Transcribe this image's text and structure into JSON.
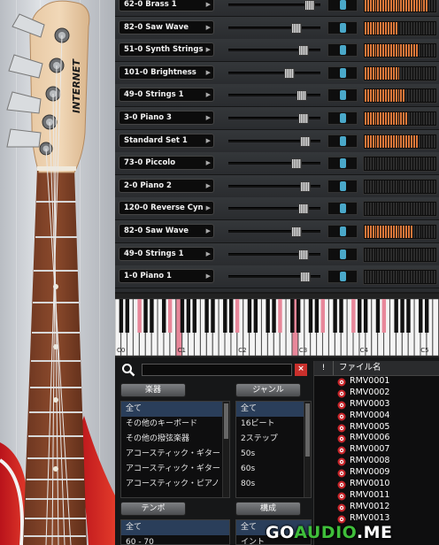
{
  "guitar": {
    "headstock_logo": "INTERNET"
  },
  "channels": [
    {
      "name": "62-0 Brass 1",
      "fader": 0.88,
      "pan": 0.5,
      "meter": [
        1,
        1,
        1,
        1,
        1,
        1,
        1,
        1,
        1,
        1,
        1,
        1,
        1,
        1,
        1,
        1,
        1,
        1,
        1,
        1,
        1,
        1,
        1,
        1,
        1,
        0,
        0,
        0
      ]
    },
    {
      "name": "82-0 Saw Wave",
      "fader": 0.74,
      "pan": 0.5,
      "meter": [
        1,
        1,
        1,
        1,
        1,
        1,
        1,
        1,
        1,
        1,
        1,
        1,
        1,
        0,
        0,
        0,
        0,
        0,
        0,
        0,
        0,
        0,
        0,
        0,
        0,
        0,
        0,
        0
      ]
    },
    {
      "name": "51-0 Synth Strings",
      "fader": 0.82,
      "pan": 0.5,
      "meter": [
        1,
        1,
        1,
        1,
        1,
        1,
        1,
        1,
        1,
        1,
        1,
        1,
        1,
        1,
        1,
        1,
        1,
        1,
        1,
        1,
        1,
        0,
        0,
        0,
        0,
        0,
        0,
        0
      ]
    },
    {
      "name": "101-0 Brightness",
      "fader": 0.66,
      "pan": 0.5,
      "meter": [
        1,
        1,
        1,
        1,
        1,
        1,
        1,
        1,
        1,
        1,
        1,
        1,
        1,
        1,
        0,
        0,
        0,
        0,
        0,
        0,
        0,
        0,
        0,
        0,
        0,
        0,
        0,
        0
      ]
    },
    {
      "name": "49-0 Strings 1",
      "fader": 0.8,
      "pan": 0.5,
      "meter": [
        1,
        1,
        1,
        1,
        1,
        1,
        1,
        1,
        1,
        1,
        1,
        1,
        1,
        1,
        1,
        1,
        0,
        0,
        0,
        0,
        0,
        0,
        0,
        0,
        0,
        0,
        0,
        0
      ]
    },
    {
      "name": "3-0 Piano 3",
      "fader": 0.82,
      "pan": 0.5,
      "meter": [
        1,
        1,
        1,
        1,
        1,
        1,
        1,
        1,
        1,
        1,
        1,
        1,
        1,
        1,
        1,
        1,
        1,
        0,
        0,
        0,
        0,
        0,
        0,
        0,
        0,
        0,
        0,
        0
      ]
    },
    {
      "name": "Standard Set 1",
      "fader": 0.84,
      "pan": 0.5,
      "meter": [
        1,
        1,
        1,
        1,
        1,
        1,
        1,
        1,
        1,
        1,
        1,
        1,
        1,
        1,
        1,
        1,
        1,
        1,
        1,
        1,
        1,
        0,
        0,
        0,
        0,
        0,
        0,
        0
      ]
    },
    {
      "name": "73-0 Piccolo",
      "fader": 0.74,
      "pan": 0.5,
      "meter": [
        0,
        0,
        0,
        0,
        0,
        0,
        0,
        0,
        0,
        0,
        0,
        0,
        0,
        0,
        0,
        0,
        0,
        0,
        0,
        0,
        0,
        0,
        0,
        0,
        0,
        0,
        0,
        0
      ]
    },
    {
      "name": "2-0 Piano 2",
      "fader": 0.84,
      "pan": 0.5,
      "meter": [
        0,
        0,
        0,
        0,
        0,
        0,
        0,
        0,
        0,
        0,
        0,
        0,
        0,
        0,
        0,
        0,
        0,
        0,
        0,
        0,
        0,
        0,
        0,
        0,
        0,
        0,
        0,
        0
      ]
    },
    {
      "name": "120-0 Reverse Cyn",
      "fader": 0.82,
      "pan": 0.5,
      "meter": [
        0,
        0,
        0,
        0,
        0,
        0,
        0,
        0,
        0,
        0,
        0,
        0,
        0,
        0,
        0,
        0,
        0,
        0,
        0,
        0,
        0,
        0,
        0,
        0,
        0,
        0,
        0,
        0
      ]
    },
    {
      "name": "82-0 Saw Wave",
      "fader": 0.74,
      "pan": 0.5,
      "meter": [
        1,
        1,
        1,
        1,
        1,
        1,
        1,
        1,
        1,
        1,
        1,
        1,
        1,
        1,
        1,
        1,
        1,
        1,
        1,
        0,
        0,
        0,
        0,
        0,
        0,
        0,
        0,
        0
      ]
    },
    {
      "name": "49-0 Strings 1",
      "fader": 0.82,
      "pan": 0.5,
      "meter": [
        0,
        0,
        0,
        0,
        0,
        0,
        0,
        0,
        0,
        0,
        0,
        0,
        0,
        0,
        0,
        0,
        0,
        0,
        0,
        0,
        0,
        0,
        0,
        0,
        0,
        0,
        0,
        0
      ]
    },
    {
      "name": "1-0 Piano 1",
      "fader": 0.84,
      "pan": 0.5,
      "meter": [
        0,
        0,
        0,
        0,
        0,
        0,
        0,
        0,
        0,
        0,
        0,
        0,
        0,
        0,
        0,
        0,
        0,
        0,
        0,
        0,
        0,
        0,
        0,
        0,
        0,
        0,
        0,
        0
      ]
    }
  ],
  "keyboard": {
    "octave_labels": [
      "C0",
      "C1",
      "C2",
      "C3",
      "C4",
      "C5"
    ],
    "highlight_color": "#e8879a",
    "pressed_white": [
      10,
      29
    ],
    "pressed_black": [
      2,
      6,
      14,
      19,
      24,
      27,
      31
    ]
  },
  "browser": {
    "search": {
      "value": "",
      "placeholder": ""
    },
    "search_clear_label": "×",
    "instrument": {
      "header": "楽器",
      "items": [
        "全て",
        "その他のキーボード",
        "その他の撥弦楽器",
        "アコースティック・ギター (",
        "アコースティック・ギター (",
        "アコースティック・ピアノ"
      ],
      "selected": 0
    },
    "genre": {
      "header": "ジャンル",
      "items": [
        "全て",
        "16ビート",
        "2ステップ",
        "50s",
        "60s",
        "80s"
      ],
      "selected": 0
    },
    "tempo": {
      "header": "テンポ",
      "items": [
        "全て",
        "60 - 70"
      ],
      "selected": 0
    },
    "structure": {
      "header": "構成",
      "items": [
        "全て",
        "イント"
      ],
      "selected": 0
    },
    "file_list": {
      "flag_header": "!",
      "name_header": "ファイル名",
      "files": [
        "RMV0001",
        "RMV0002",
        "RMV0003",
        "RMV0004",
        "RMV0005",
        "RMV0006",
        "RMV0007",
        "RMV0008",
        "RMV0009",
        "RMV0010",
        "RMV0011",
        "RMV0012",
        "RMV0013"
      ]
    }
  },
  "watermark": {
    "part1": "GO",
    "part2": "AUDIO",
    "part3": ".ME"
  },
  "colors": {
    "meter_on": "#e0783a",
    "pan_knob": "#4aa8c9",
    "clear_button": "#c9302c",
    "selection": "#2a3e5a"
  }
}
